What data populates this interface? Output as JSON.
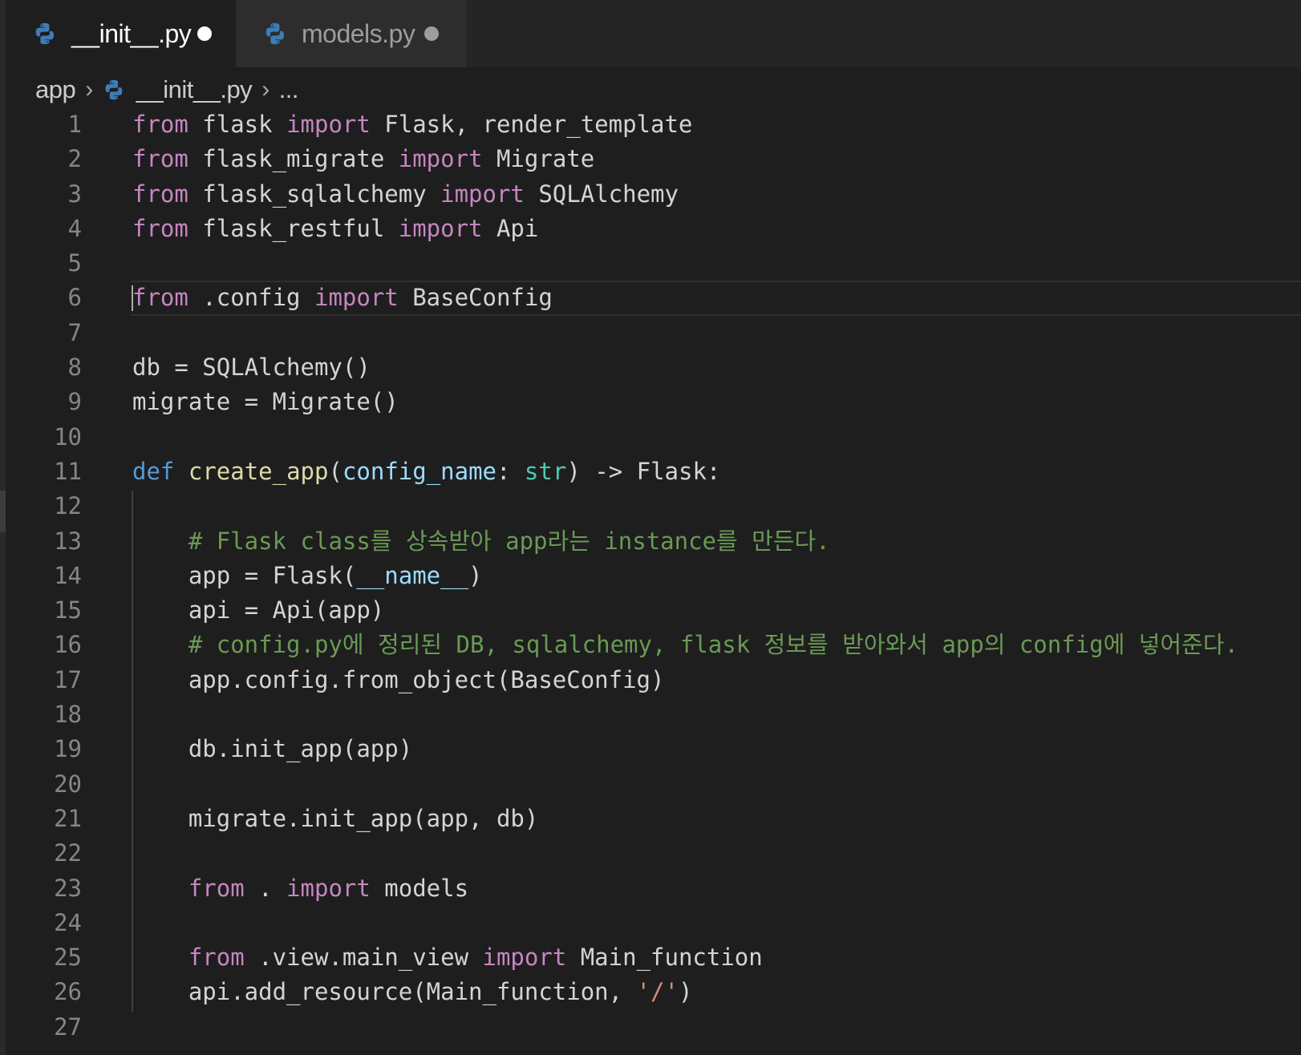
{
  "tabs": [
    {
      "label": "__init__.py",
      "active": true,
      "dirty": true,
      "icon": "python-icon"
    },
    {
      "label": "models.py",
      "active": false,
      "dirty": true,
      "icon": "python-icon"
    }
  ],
  "breadcrumb": {
    "folder": "app",
    "file": "__init__.py",
    "symbol": "..."
  },
  "colors": {
    "editor_bg": "#1e1e1e",
    "keyword": "#c586c0",
    "def_keyword": "#569cd6",
    "function": "#dcdcaa",
    "parameter": "#9cdcfe",
    "type": "#4ec9b0",
    "comment": "#6a9955",
    "string": "#ce9178",
    "text": "#d4d4d4",
    "line_number": "#858585"
  },
  "current_line": 6,
  "code_lines": [
    {
      "n": "1",
      "tokens": [
        [
          "kw",
          "from"
        ],
        [
          "plain",
          " flask "
        ],
        [
          "kw",
          "import"
        ],
        [
          "plain",
          " Flask, render_template"
        ]
      ]
    },
    {
      "n": "2",
      "tokens": [
        [
          "kw",
          "from"
        ],
        [
          "plain",
          " flask_migrate "
        ],
        [
          "kw",
          "import"
        ],
        [
          "plain",
          " Migrate"
        ]
      ]
    },
    {
      "n": "3",
      "tokens": [
        [
          "kw",
          "from"
        ],
        [
          "plain",
          " flask_sqlalchemy "
        ],
        [
          "kw",
          "import"
        ],
        [
          "plain",
          " SQLAlchemy"
        ]
      ]
    },
    {
      "n": "4",
      "tokens": [
        [
          "kw",
          "from"
        ],
        [
          "plain",
          " flask_restful "
        ],
        [
          "kw",
          "import"
        ],
        [
          "plain",
          " Api"
        ]
      ]
    },
    {
      "n": "5",
      "tokens": []
    },
    {
      "n": "6",
      "tokens": [
        [
          "kw",
          "from"
        ],
        [
          "plain",
          " .config "
        ],
        [
          "kw",
          "import"
        ],
        [
          "plain",
          " BaseConfig"
        ]
      ]
    },
    {
      "n": "7",
      "tokens": []
    },
    {
      "n": "8",
      "tokens": [
        [
          "plain",
          "db = SQLAlchemy()"
        ]
      ]
    },
    {
      "n": "9",
      "tokens": [
        [
          "plain",
          "migrate = Migrate()"
        ]
      ]
    },
    {
      "n": "10",
      "tokens": []
    },
    {
      "n": "11",
      "tokens": [
        [
          "def",
          "def"
        ],
        [
          "plain",
          " "
        ],
        [
          "fn",
          "create_app"
        ],
        [
          "plain",
          "("
        ],
        [
          "param",
          "config_name"
        ],
        [
          "plain",
          ": "
        ],
        [
          "type",
          "str"
        ],
        [
          "plain",
          ") -> Flask:"
        ]
      ]
    },
    {
      "n": "12",
      "tokens": []
    },
    {
      "n": "13",
      "tokens": [
        [
          "plain",
          "    "
        ],
        [
          "cm",
          "# Flask class를 상속받아 app라는 instance를 만든다."
        ]
      ]
    },
    {
      "n": "14",
      "tokens": [
        [
          "plain",
          "    app = Flask("
        ],
        [
          "var",
          "__name__"
        ],
        [
          "plain",
          ")"
        ]
      ]
    },
    {
      "n": "15",
      "tokens": [
        [
          "plain",
          "    api = Api(app)"
        ]
      ]
    },
    {
      "n": "16",
      "tokens": [
        [
          "plain",
          "    "
        ],
        [
          "cm",
          "# config.py에 정리된 DB, sqlalchemy, flask 정보를 받아와서 app의 config에 넣어준다."
        ]
      ]
    },
    {
      "n": "17",
      "tokens": [
        [
          "plain",
          "    app.config.from_object(BaseConfig)"
        ]
      ]
    },
    {
      "n": "18",
      "tokens": []
    },
    {
      "n": "19",
      "tokens": [
        [
          "plain",
          "    db.init_app(app)"
        ]
      ]
    },
    {
      "n": "20",
      "tokens": []
    },
    {
      "n": "21",
      "tokens": [
        [
          "plain",
          "    migrate.init_app(app, db)"
        ]
      ]
    },
    {
      "n": "22",
      "tokens": []
    },
    {
      "n": "23",
      "tokens": [
        [
          "plain",
          "    "
        ],
        [
          "kw",
          "from"
        ],
        [
          "plain",
          " . "
        ],
        [
          "kw",
          "import"
        ],
        [
          "plain",
          " models"
        ]
      ]
    },
    {
      "n": "24",
      "tokens": []
    },
    {
      "n": "25",
      "tokens": [
        [
          "plain",
          "    "
        ],
        [
          "kw",
          "from"
        ],
        [
          "plain",
          " .view.main_view "
        ],
        [
          "kw",
          "import"
        ],
        [
          "plain",
          " Main_function"
        ]
      ]
    },
    {
      "n": "26",
      "tokens": [
        [
          "plain",
          "    api.add_resource(Main_function, "
        ],
        [
          "str",
          "'/'"
        ],
        [
          "plain",
          ")"
        ]
      ]
    },
    {
      "n": "27",
      "tokens": []
    }
  ]
}
